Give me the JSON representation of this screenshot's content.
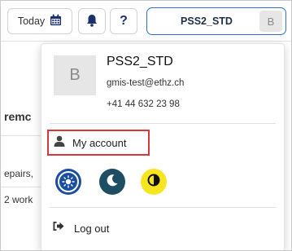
{
  "toolbar": {
    "today_label": "Today",
    "calendar_icon": "calendar-icon",
    "bell_icon": "bell-icon",
    "help_label": "?",
    "account_name": "PSS2_STD",
    "account_initial": "B"
  },
  "background": {
    "heading_fragment": "remc",
    "text_fragment_1": "epairs,",
    "text_fragment_2": "2 work"
  },
  "dropdown": {
    "avatar_initial": "B",
    "name": "PSS2_STD",
    "email": "gmis-test@ethz.ch",
    "phone": "+41 44 632 23 98",
    "my_account_label": "My account",
    "my_account_icon": "user-icon",
    "themes": [
      {
        "name": "light",
        "icon": "sun-icon",
        "color": "#1a4fa0"
      },
      {
        "name": "dark",
        "icon": "moon-icon",
        "color": "#1d4e63"
      },
      {
        "name": "contrast",
        "icon": "contrast-icon",
        "color": "#f7e51f"
      }
    ],
    "logout_label": "Log out",
    "logout_icon": "logout-icon"
  },
  "colors": {
    "accent": "#2e6fd2",
    "highlight_border": "#d9363e",
    "brand_navy": "#1c2f6e"
  }
}
